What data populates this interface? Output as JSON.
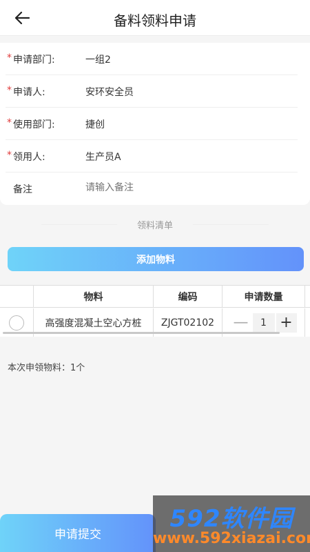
{
  "header": {
    "title": "备料领料申请",
    "back_icon": "arrow-left-icon"
  },
  "form": {
    "fields": [
      {
        "label": "申请部门:",
        "value": "一组2",
        "required": true
      },
      {
        "label": "申请人:",
        "value": "安环安全员",
        "required": true
      },
      {
        "label": "使用部门:",
        "value": "捷创",
        "required": true
      },
      {
        "label": "领用人:",
        "value": "生产员A",
        "required": true
      },
      {
        "label": "备注",
        "value": "",
        "placeholder": "请输入备注",
        "required": false
      }
    ],
    "required_mark": "*"
  },
  "materials": {
    "section_title": "领料清单",
    "add_button": "添加物料",
    "table": {
      "headers": [
        "物料",
        "编码",
        "申请数量"
      ],
      "rows": [
        {
          "material": "高强度混凝土空心方桩",
          "code": "ZJGT02102",
          "quantity": "1"
        }
      ]
    },
    "stepper": {
      "minus": "—",
      "plus": "+"
    },
    "summary": "本次申领物料：1个"
  },
  "footer": {
    "submit_button": "申请提交"
  },
  "watermark": {
    "brand": "592软件园",
    "url": "www.592xiazai.com"
  },
  "colors": {
    "accent_start": "#6fd3f9",
    "accent_end": "#6392fa",
    "required": "#e03c3c"
  }
}
